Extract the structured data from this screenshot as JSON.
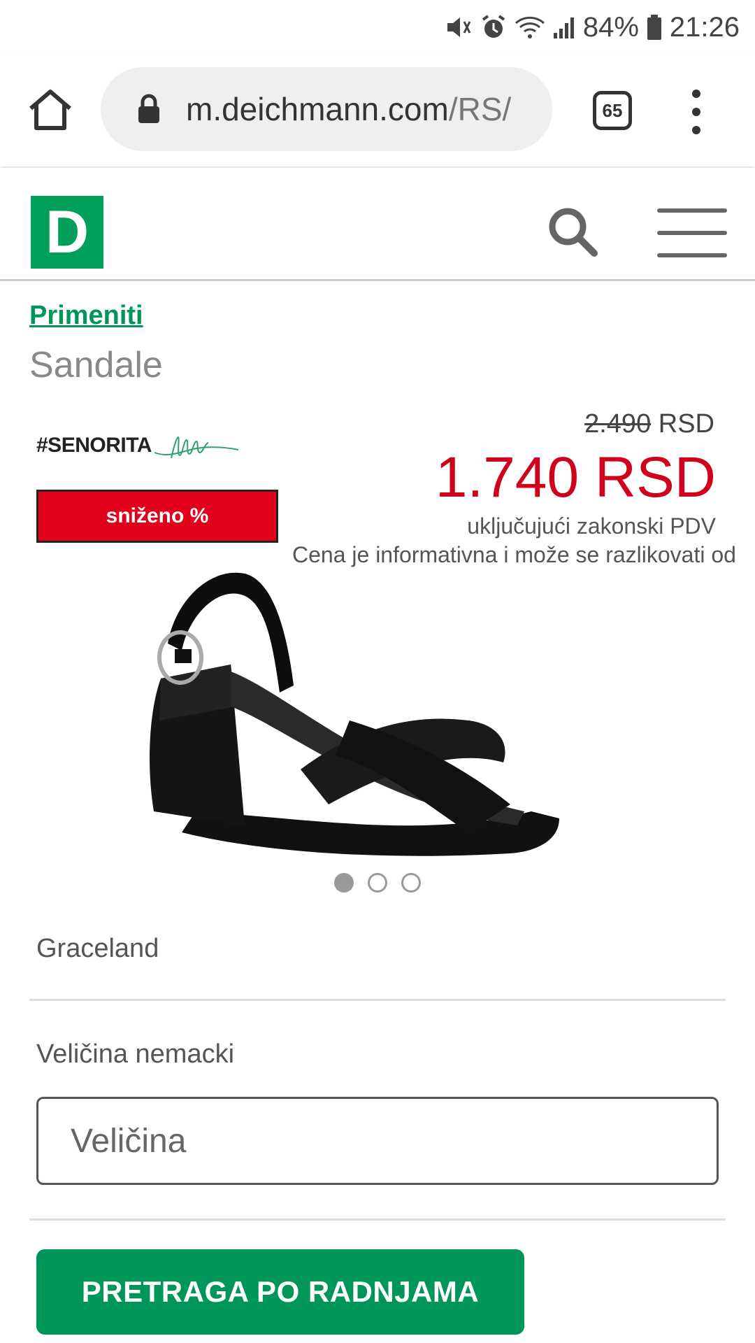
{
  "status_bar": {
    "battery": "84%",
    "time": "21:26",
    "icons": [
      "mute-vibrate-icon",
      "alarm-icon",
      "wifi-icon",
      "signal-icon",
      "battery-icon"
    ]
  },
  "browser": {
    "url_host": "m.deichmann.com",
    "url_path": "/RS/",
    "tab_count": "65",
    "icons": [
      "home-icon",
      "lock-icon",
      "tabs-icon",
      "more-vert-icon"
    ]
  },
  "header": {
    "logo_letter": "D",
    "icons": [
      "search-icon",
      "hamburger-menu-icon"
    ]
  },
  "product": {
    "apply_link": "Primeniti",
    "type": "Sandale",
    "collection_tag": "#SENORITA",
    "sale_badge": "sniženo %",
    "old_price_value": "2.490",
    "old_price_currency": "RSD",
    "new_price": "1.740 RSD",
    "vat_note": "uključujući zakonski PDV",
    "price_note": "Cena je informativna i može se razlikovati od",
    "brand": "Graceland",
    "size_label": "Veličina nemacki",
    "size_placeholder": "Veličina",
    "store_search_button": "PRETRAGA PO RADNJAMA",
    "gallery_dots": 3,
    "gallery_active": 1
  },
  "colors": {
    "brand_green": "#00a05a",
    "button_green": "#00965a",
    "sale_red": "#e3001b",
    "price_red": "#d0021b"
  }
}
